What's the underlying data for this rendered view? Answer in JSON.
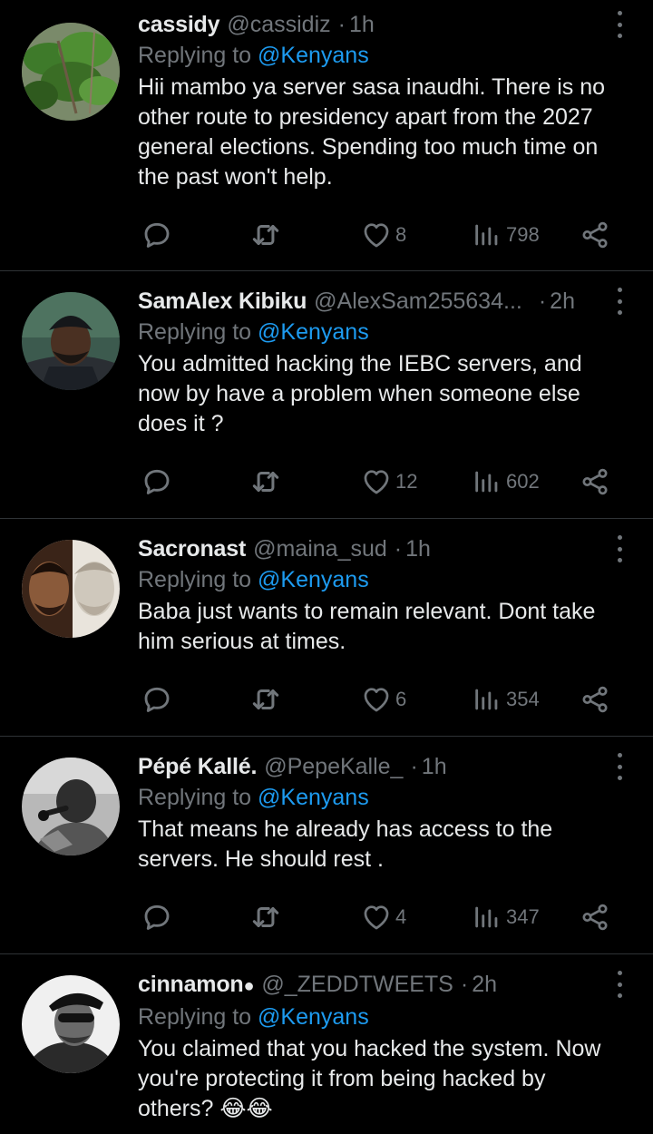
{
  "tweets": [
    {
      "name": "cassidy",
      "handle": "@cassidiz",
      "separator": "·",
      "time": "1h",
      "replying_prefix": "Replying to",
      "replying_to": "@Kenyans",
      "lines": [
        "Hii mambo ya server sasa inaudhi. There is no",
        "other route to presidency apart from the 2027",
        "general elections. Spending too much time on",
        "the past won't help."
      ],
      "replies": "",
      "retweets": "",
      "likes": "8",
      "views": "798",
      "avatar": "green-plant-photo"
    },
    {
      "name": "SamAlex Kibiku",
      "handle": "@AlexSam255634...",
      "separator": "·",
      "time": "2h",
      "replying_prefix": "Replying to",
      "replying_to": "@Kenyans",
      "lines": [
        "You admitted hacking the IEBC servers, and",
        "now by have a problem when someone else",
        "does it ?"
      ],
      "replies": "",
      "retweets": "",
      "likes": "12",
      "views": "602",
      "avatar": "man-in-beanie-photo"
    },
    {
      "name": "Sacronast",
      "handle": "@maina_sud",
      "separator": "·",
      "time": "1h",
      "replying_prefix": "Replying to",
      "replying_to": "@Kenyans",
      "lines": [
        "Baba just wants to remain relevant. Dont take",
        "him serious at times."
      ],
      "replies": "",
      "retweets": "",
      "likes": "6",
      "views": "354",
      "avatar": "two-faces-statue-photo"
    },
    {
      "name": "Pépé Kallé.",
      "handle": "@PepeKalle_",
      "separator": "·",
      "time": "1h",
      "replying_prefix": "Replying to",
      "replying_to": "@Kenyans",
      "lines": [
        "That means he already has access to the",
        "servers. He should rest ."
      ],
      "replies": "",
      "retweets": "",
      "likes": "4",
      "views": "347",
      "avatar": "singer-with-microphone-bw-photo"
    },
    {
      "name": "cinnamon",
      "name_suffix": "",
      "handle": "@_ZEDDTWEETS",
      "separator": "·",
      "time": "2h",
      "replying_prefix": "Replying to",
      "replying_to": "@Kenyans",
      "lines": [
        "You claimed that you hacked the system. Now",
        "you're protecting it from being hacked by",
        "others? 😂😂"
      ],
      "replies": "",
      "retweets": "",
      "likes": "",
      "views": "",
      "avatar": "man-in-cap-sunglasses-bw-photo"
    }
  ],
  "icons": {
    "reply": "reply-bubble-icon",
    "retweet": "retweet-icon",
    "like": "heart-icon",
    "views": "views-bar-chart-icon",
    "share": "share-icon",
    "more": "more-vertical-icon"
  },
  "colors": {
    "background": "#000000",
    "text": "#e7e9ea",
    "secondary": "#71767b",
    "link": "#1d9bf0",
    "divider": "#2f3336"
  }
}
